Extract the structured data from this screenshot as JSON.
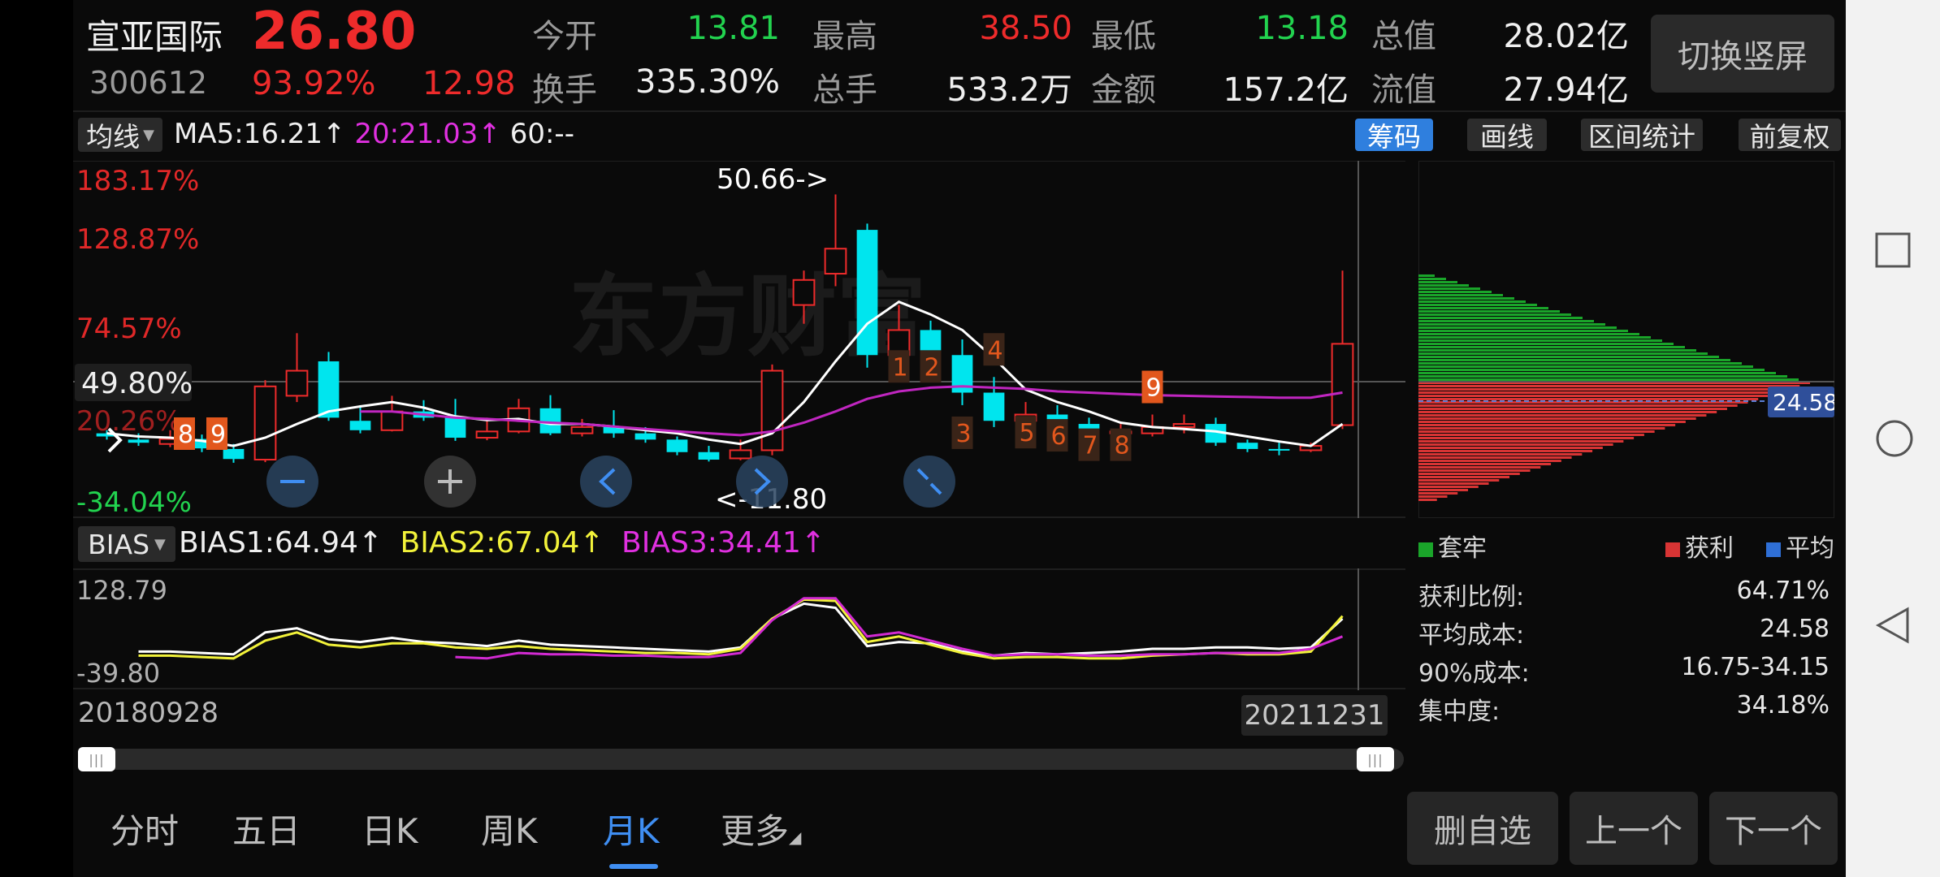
{
  "stock": {
    "name": "宣亚国际",
    "price": "26.80",
    "code": "300612",
    "change_pct": "93.92%",
    "change_amt": "12.98"
  },
  "quote": {
    "open": {
      "label": "今开",
      "value": "13.81"
    },
    "high": {
      "label": "最高",
      "value": "38.50"
    },
    "low": {
      "label": "最低",
      "value": "13.18"
    },
    "total_value": {
      "label": "总值",
      "value": "28.02亿"
    },
    "turnover": {
      "label": "换手",
      "value": "335.30%"
    },
    "volume": {
      "label": "总手",
      "value": "533.2万"
    },
    "amount": {
      "label": "金额",
      "value": "157.2亿"
    },
    "float_value": {
      "label": "流值",
      "value": "27.94亿"
    }
  },
  "switch_button": "切换竖屏",
  "ma_bar": {
    "selector": "均线",
    "ma5": "MA5:16.21",
    "ma20": "20:21.03",
    "ma60": "60:--",
    "up": "↑"
  },
  "tools": {
    "chips": "筹码",
    "draw": "画线",
    "stats": "区间统计",
    "adjust": "前复权"
  },
  "y_labels": {
    "l1": "183.17%",
    "l2": "128.87%",
    "l3": "74.57%",
    "l4": "49.80%",
    "l5": "20.26%",
    "l6": "-34.04%"
  },
  "annotations": {
    "max": "50.66->",
    "min": "<-11.80"
  },
  "td_numbers_left": [
    "8",
    "9"
  ],
  "td_numbers_right": [
    "1",
    "2",
    "3",
    "4",
    "5",
    "6",
    "7",
    "8",
    "9"
  ],
  "price_tag": "24.58",
  "bias": {
    "selector": "BIAS",
    "b1": "BIAS1:64.94↑",
    "b2": "BIAS2:67.04↑",
    "b3": "BIAS3:34.41↑",
    "top": "128.79",
    "bottom": "-39.80"
  },
  "dates": {
    "start": "20180928",
    "end": "20211231"
  },
  "chip_legend": {
    "trapped": "套牢",
    "profit": "获利",
    "avg": "平均"
  },
  "chip_stats": [
    {
      "label": "获利比例:",
      "value": "64.71%"
    },
    {
      "label": "平均成本:",
      "value": "24.58"
    },
    {
      "label": "90%成本:",
      "value": "16.75-34.15"
    },
    {
      "label": "集中度:",
      "value": "34.18%"
    }
  ],
  "tabs": [
    "分时",
    "五日",
    "日K",
    "周K",
    "月K",
    "更多"
  ],
  "active_tab": "月K",
  "buttons": {
    "delete_fav": "删自选",
    "prev": "上一个",
    "next": "下一个"
  },
  "watermark": "东方财富",
  "colors": {
    "up": "#ee2b2b",
    "down": "#00e5ee",
    "ma5": "#ffffff",
    "ma20": "#c026c0",
    "trapped": "#1aa52a",
    "profit": "#d83434",
    "accent": "#2f7fde"
  },
  "chart_data": {
    "type": "candlestick",
    "series_ma5": "MA5",
    "candles": [
      {
        "o": 12.5,
        "c": 12.0,
        "h": 13.0,
        "l": 11.5
      },
      {
        "o": 11.5,
        "c": 11.0,
        "h": 12.5,
        "l": 10.5
      },
      {
        "o": 10.8,
        "c": 11.6,
        "h": 13.0,
        "l": 10.3
      },
      {
        "o": 11.6,
        "c": 10.1,
        "h": 12.3,
        "l": 9.5
      },
      {
        "o": 10.0,
        "c": 8.4,
        "h": 10.8,
        "l": 7.8
      },
      {
        "o": 8.3,
        "c": 20.0,
        "h": 21.0,
        "l": 7.9
      },
      {
        "o": 18.5,
        "c": 22.5,
        "h": 28.5,
        "l": 17.5
      },
      {
        "o": 24.0,
        "c": 15.0,
        "h": 25.5,
        "l": 14.5
      },
      {
        "o": 14.5,
        "c": 13.0,
        "h": 17.0,
        "l": 12.5
      },
      {
        "o": 13.0,
        "c": 16.0,
        "h": 18.5,
        "l": 12.8
      },
      {
        "o": 16.0,
        "c": 15.0,
        "h": 17.8,
        "l": 14.5
      },
      {
        "o": 15.0,
        "c": 11.8,
        "h": 18.0,
        "l": 11.3
      },
      {
        "o": 11.8,
        "c": 12.8,
        "h": 15.0,
        "l": 11.4
      },
      {
        "o": 12.8,
        "c": 16.5,
        "h": 18.0,
        "l": 12.5
      },
      {
        "o": 16.5,
        "c": 12.5,
        "h": 18.6,
        "l": 12.2
      },
      {
        "o": 12.5,
        "c": 13.5,
        "h": 14.8,
        "l": 12.0
      },
      {
        "o": 13.5,
        "c": 12.5,
        "h": 16.2,
        "l": 11.8
      },
      {
        "o": 12.5,
        "c": 11.5,
        "h": 13.5,
        "l": 11.0
      },
      {
        "o": 11.5,
        "c": 9.5,
        "h": 12.0,
        "l": 9.0
      },
      {
        "o": 9.5,
        "c": 8.3,
        "h": 10.5,
        "l": 8.0
      },
      {
        "o": 8.5,
        "c": 9.8,
        "h": 11.5,
        "l": 8.2
      },
      {
        "o": 9.8,
        "c": 22.5,
        "h": 23.5,
        "l": 9.0
      },
      {
        "o": 33.0,
        "c": 37.0,
        "h": 38.5,
        "l": 30.0
      },
      {
        "o": 38.0,
        "c": 42.0,
        "h": 50.66,
        "l": 36.0
      },
      {
        "o": 45.0,
        "c": 25.0,
        "h": 46.0,
        "l": 23.0
      },
      {
        "o": 25.0,
        "c": 29.0,
        "h": 33.0,
        "l": 23.5
      },
      {
        "o": 29.0,
        "c": 25.0,
        "h": 30.5,
        "l": 24.0
      },
      {
        "o": 25.0,
        "c": 19.0,
        "h": 27.5,
        "l": 17.0
      },
      {
        "o": 19.0,
        "c": 14.5,
        "h": 21.5,
        "l": 13.5
      },
      {
        "o": 14.5,
        "c": 15.5,
        "h": 17.5,
        "l": 12.5
      },
      {
        "o": 15.5,
        "c": 14.0,
        "h": 17.0,
        "l": 13.5
      },
      {
        "o": 14.0,
        "c": 12.5,
        "h": 15.0,
        "l": 12.0
      },
      {
        "o": 12.5,
        "c": 12.8,
        "h": 14.0,
        "l": 12.0
      },
      {
        "o": 12.5,
        "c": 13.5,
        "h": 15.5,
        "l": 12.0
      },
      {
        "o": 13.5,
        "c": 14.0,
        "h": 15.5,
        "l": 12.5
      },
      {
        "o": 14.0,
        "c": 11.0,
        "h": 15.0,
        "l": 10.5
      },
      {
        "o": 11.0,
        "c": 10.0,
        "h": 11.5,
        "l": 9.5
      },
      {
        "o": 10.0,
        "c": 9.8,
        "h": 11.0,
        "l": 9.0
      },
      {
        "o": 9.8,
        "c": 10.5,
        "h": 11.0,
        "l": 9.5
      },
      {
        "o": 13.81,
        "c": 26.8,
        "h": 38.5,
        "l": 13.18
      }
    ],
    "ma5": [
      12.5,
      12.0,
      11.8,
      11.3,
      10.5,
      11.8,
      14.0,
      16.0,
      16.8,
      17.5,
      16.6,
      15.2,
      14.6,
      14.8,
      14.0,
      14.0,
      13.6,
      13.0,
      12.5,
      11.5,
      10.8,
      12.5,
      17.5,
      24.0,
      30.0,
      33.5,
      31.5,
      29.0,
      24.5,
      19.5,
      17.5,
      16.0,
      14.2,
      13.5,
      13.2,
      12.8,
      12.0,
      11.2,
      10.5,
      14.0
    ],
    "ma20": [
      null,
      null,
      null,
      null,
      null,
      null,
      null,
      null,
      16.0,
      16.0,
      15.5,
      15.0,
      14.8,
      14.5,
      14.2,
      14.0,
      13.6,
      13.2,
      12.8,
      12.5,
      12.2,
      12.8,
      14.2,
      16.0,
      18.0,
      19.2,
      19.8,
      20.0,
      19.8,
      19.6,
      19.2,
      19.0,
      18.8,
      18.6,
      18.5,
      18.4,
      18.3,
      18.2,
      18.2,
      19.0
    ],
    "ma_y_range": [
      0,
      55
    ],
    "bias1": [
      null,
      12,
      12,
      10,
      8,
      40,
      46,
      30,
      26,
      32,
      26,
      24,
      20,
      28,
      22,
      20,
      18,
      16,
      14,
      12,
      18,
      60,
      82,
      76,
      20,
      26,
      24,
      12,
      6,
      10,
      8,
      10,
      12,
      16,
      16,
      18,
      18,
      16,
      18,
      60
    ],
    "bias2": [
      null,
      6,
      6,
      4,
      2,
      28,
      40,
      22,
      18,
      24,
      24,
      18,
      16,
      20,
      16,
      14,
      12,
      10,
      10,
      8,
      16,
      60,
      88,
      86,
      26,
      34,
      22,
      10,
      2,
      4,
      4,
      2,
      2,
      6,
      8,
      10,
      8,
      8,
      12,
      64
    ],
    "bias3": [
      null,
      null,
      null,
      null,
      null,
      null,
      null,
      null,
      null,
      null,
      null,
      4,
      2,
      10,
      8,
      8,
      6,
      6,
      4,
      4,
      10,
      58,
      90,
      90,
      34,
      40,
      28,
      16,
      6,
      8,
      8,
      6,
      6,
      8,
      8,
      10,
      10,
      10,
      16,
      34
    ],
    "bias_range": [
      -39.8,
      128.79
    ]
  }
}
